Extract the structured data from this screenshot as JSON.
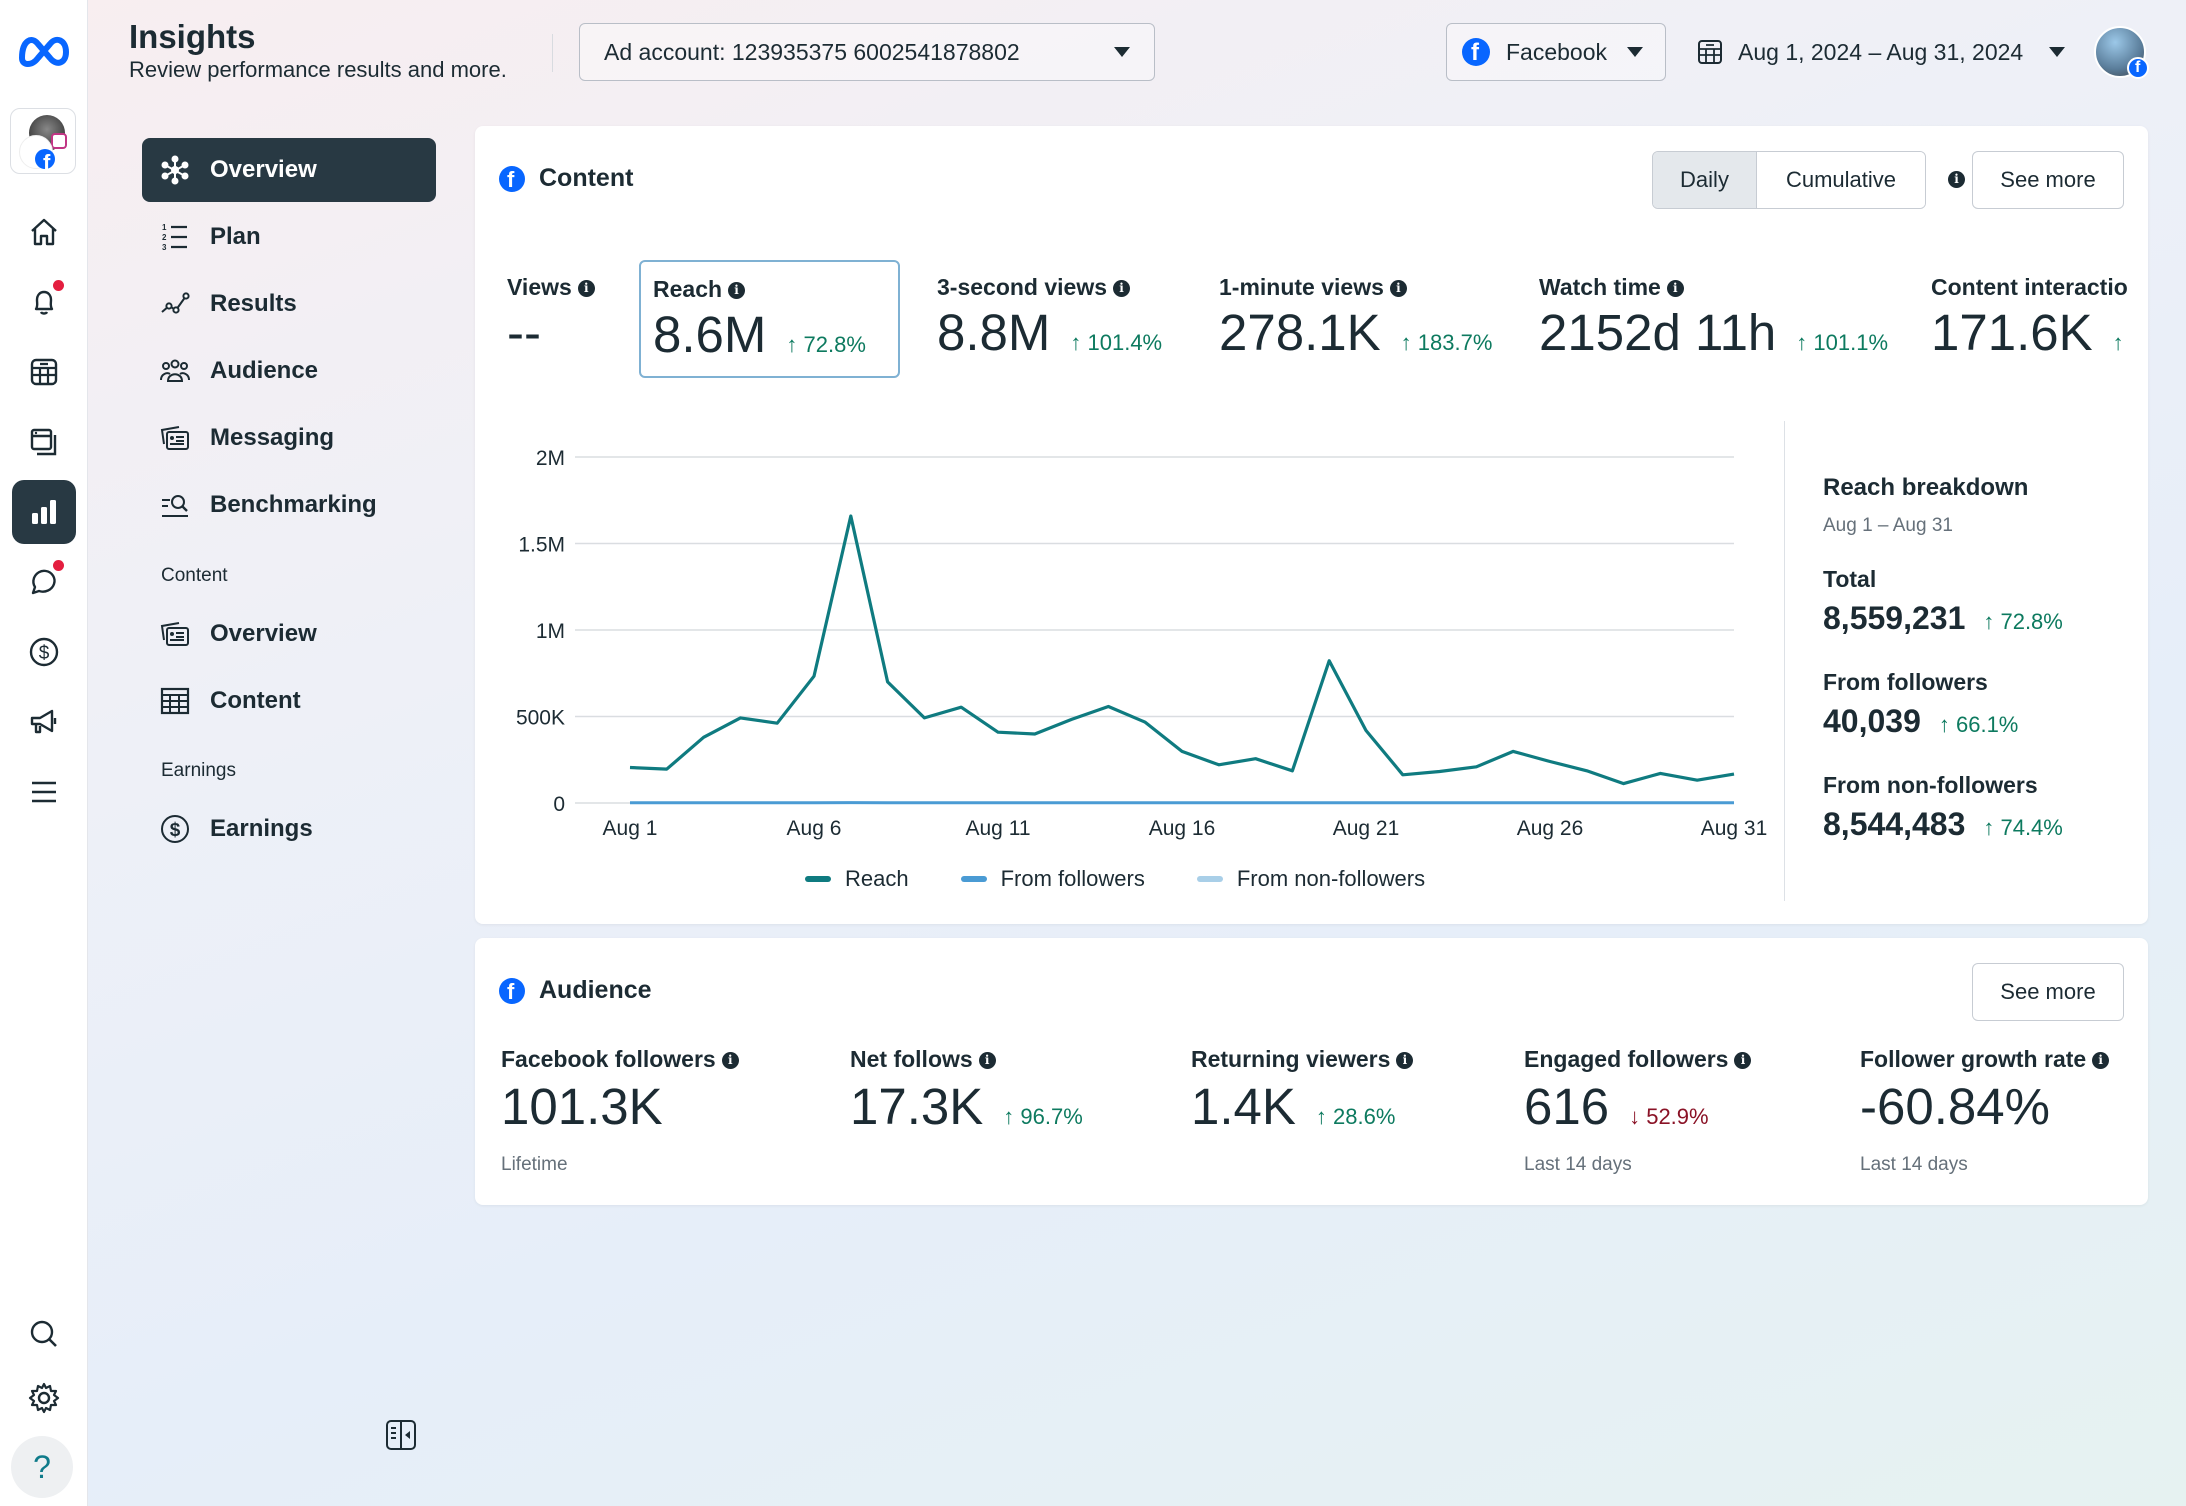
{
  "header": {
    "title": "Insights",
    "subtitle": "Review performance results and more.",
    "ad_account_label": "Ad account: 123935375 6002541878802",
    "platform_label": "Facebook",
    "date_range_label": "Aug 1, 2024 – Aug 31, 2024"
  },
  "rail": {
    "items": [
      "meta-logo",
      "account-switcher",
      "home",
      "notifications",
      "planner",
      "content-library",
      "insights",
      "inbox",
      "monetization",
      "ads",
      "all-tools",
      "search",
      "settings",
      "help"
    ],
    "help_glyph": "?"
  },
  "nav": {
    "items": [
      {
        "label": "Overview",
        "icon": "hub-icon",
        "active": true
      },
      {
        "label": "Plan",
        "icon": "numbered-list-icon"
      },
      {
        "label": "Results",
        "icon": "trend-line-icon"
      },
      {
        "label": "Audience",
        "icon": "people-icon"
      },
      {
        "label": "Messaging",
        "icon": "cards-icon"
      },
      {
        "label": "Benchmarking",
        "icon": "compare-search-icon"
      }
    ],
    "content_section_label": "Content",
    "content_items": [
      {
        "label": "Overview",
        "icon": "cards-icon"
      },
      {
        "label": "Content",
        "icon": "table-icon"
      }
    ],
    "earnings_section_label": "Earnings",
    "earnings_items": [
      {
        "label": "Earnings",
        "icon": "dollar-circle-icon"
      }
    ]
  },
  "content_card": {
    "title": "Content",
    "toggle": {
      "daily": "Daily",
      "cumulative": "Cumulative",
      "selected": "Daily"
    },
    "see_more": "See more",
    "metrics": [
      {
        "label": "Views",
        "value": "--",
        "delta": ""
      },
      {
        "label": "Reach",
        "value": "8.6M",
        "delta": "↑ 72.8%",
        "selected": true
      },
      {
        "label": "3-second views",
        "value": "8.8M",
        "delta": "↑ 101.4%"
      },
      {
        "label": "1-minute views",
        "value": "278.1K",
        "delta": "↑ 183.7%"
      },
      {
        "label": "Watch time",
        "value": "2152d 11h",
        "delta": "↑ 101.1%"
      },
      {
        "label": "Content interactio",
        "value": "171.6K",
        "delta": "↑"
      }
    ],
    "breakdown": {
      "title": "Reach breakdown",
      "range": "Aug 1 – Aug 31",
      "rows": [
        {
          "label": "Total",
          "value": "8,559,231",
          "delta": "↑ 72.8%"
        },
        {
          "label": "From followers",
          "value": "40,039",
          "delta": "↑ 66.1%"
        },
        {
          "label": "From non-followers",
          "value": "8,544,483",
          "delta": "↑ 74.4%"
        }
      ]
    }
  },
  "audience_card": {
    "title": "Audience",
    "see_more": "See more",
    "metrics": [
      {
        "label": "Facebook followers",
        "value": "101.3K",
        "delta": "",
        "sub": "Lifetime"
      },
      {
        "label": "Net follows",
        "value": "17.3K",
        "delta": "↑ 96.7%",
        "sub": ""
      },
      {
        "label": "Returning viewers",
        "value": "1.4K",
        "delta": "↑ 28.6%",
        "sub": ""
      },
      {
        "label": "Engaged followers",
        "value": "616",
        "delta": "↓ 52.9%",
        "delta_dir": "down",
        "sub": "Last 14 days"
      },
      {
        "label": "Follower growth rate",
        "value": "-60.84%",
        "delta": "",
        "sub": "Last 14 days"
      }
    ]
  },
  "colors": {
    "accent_dark": "#283943",
    "facebook_blue": "#0866ff",
    "positive": "#0d7a5f",
    "negative": "#8a1226",
    "reach_line": "#0f7b80",
    "followers_line": "#4a9bd4",
    "non_followers_line": "#a9cfe8"
  },
  "chart_data": {
    "type": "line",
    "title": "",
    "xlabel": "",
    "ylabel": "",
    "ylim": [
      0,
      2000000
    ],
    "yticks": [
      0,
      500000,
      1000000,
      1500000,
      2000000
    ],
    "ytick_labels": [
      "0",
      "500K",
      "1M",
      "1.5M",
      "2M"
    ],
    "x": [
      "Aug 1",
      "Aug 2",
      "Aug 3",
      "Aug 4",
      "Aug 5",
      "Aug 6",
      "Aug 7",
      "Aug 8",
      "Aug 9",
      "Aug 10",
      "Aug 11",
      "Aug 12",
      "Aug 13",
      "Aug 14",
      "Aug 15",
      "Aug 16",
      "Aug 17",
      "Aug 18",
      "Aug 19",
      "Aug 20",
      "Aug 21",
      "Aug 22",
      "Aug 23",
      "Aug 24",
      "Aug 25",
      "Aug 26",
      "Aug 27",
      "Aug 28",
      "Aug 29",
      "Aug 30",
      "Aug 31"
    ],
    "xtick_labels": [
      "Aug 1",
      "Aug 6",
      "Aug 11",
      "Aug 16",
      "Aug 21",
      "Aug 26",
      "Aug 31"
    ],
    "grid": true,
    "legend_position": "bottom",
    "series": [
      {
        "name": "Reach",
        "color": "#0f7b80",
        "values": [
          205000,
          196000,
          380000,
          492000,
          461000,
          733000,
          1659000,
          700000,
          492000,
          554000,
          409000,
          399000,
          483000,
          558000,
          467000,
          298000,
          221000,
          256000,
          186000,
          822000,
          419000,
          163000,
          182000,
          209000,
          298000,
          240000,
          186000,
          112000,
          171000,
          132000,
          167000
        ]
      },
      {
        "name": "From followers",
        "color": "#4a9bd4",
        "values": [
          1000,
          1100,
          1200,
          1300,
          1200,
          1500,
          2500,
          2000,
          1600,
          1400,
          1200,
          1300,
          1500,
          1700,
          1300,
          1200,
          1100,
          1200,
          1100,
          1800,
          1500,
          1000,
          1000,
          1100,
          1200,
          1200,
          1100,
          900,
          1000,
          900,
          1000
        ]
      },
      {
        "name": "From non-followers",
        "color": "#a9cfe8",
        "values": [
          204000,
          194900,
          378800,
          490700,
          459800,
          731500,
          1656500,
          698000,
          490400,
          552600,
          407800,
          397700,
          481500,
          556300,
          465700,
          296800,
          219900,
          254800,
          184900,
          820200,
          417500,
          162000,
          181000,
          207900,
          296800,
          238800,
          184900,
          111100,
          170000,
          131100,
          166000
        ]
      }
    ]
  }
}
